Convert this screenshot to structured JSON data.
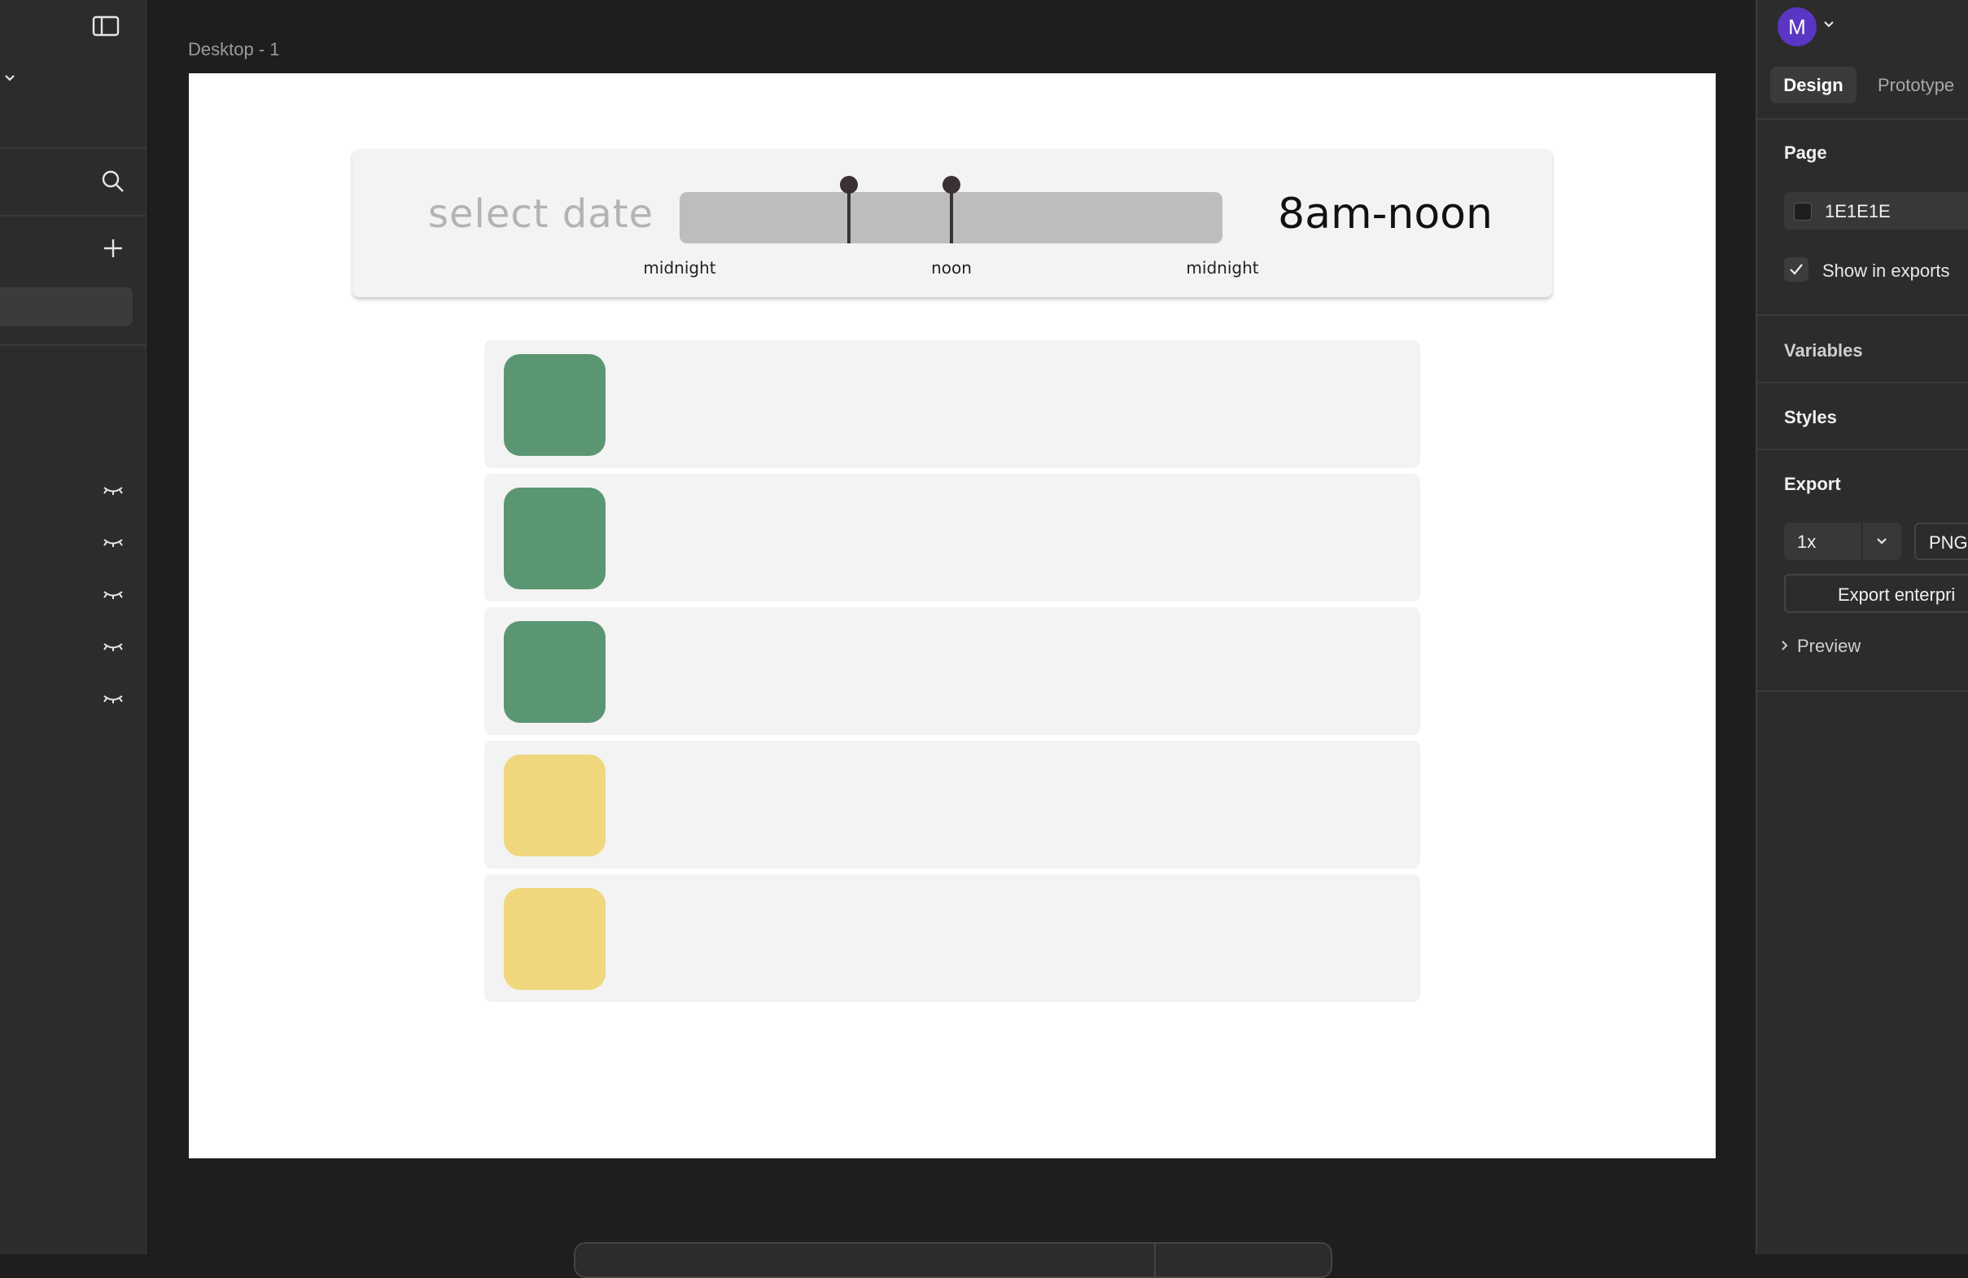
{
  "canvas": {
    "frame_label": "Desktop - 1",
    "background_color": "#1e1e1e",
    "frame_color": "#ffffff"
  },
  "mockup": {
    "date_placeholder": "select date",
    "range_text": "8am-noon",
    "slider": {
      "track_color": "#bdbdbd",
      "handle_color": "#3a3232",
      "start_fraction": 0.3125,
      "end_fraction": 0.5,
      "tick_labels": [
        "midnight",
        "noon",
        "midnight"
      ]
    },
    "rows": [
      {
        "swatch_color": "#5b9672"
      },
      {
        "swatch_color": "#5b9672"
      },
      {
        "swatch_color": "#5b9672"
      },
      {
        "swatch_color": "#f0d77d"
      },
      {
        "swatch_color": "#f0d77d"
      }
    ]
  },
  "left_sidebar": {
    "icons": [
      "sidebar-toggle-icon",
      "chevron-down-icon",
      "search-icon",
      "plus-icon"
    ],
    "hidden_layer_icons": [
      "eye-closed-icon",
      "eye-closed-icon",
      "eye-closed-icon",
      "eye-closed-icon",
      "eye-closed-icon"
    ]
  },
  "right_panel": {
    "avatar_initial": "M",
    "tabs": [
      "Design",
      "Prototype"
    ],
    "page": {
      "title": "Page",
      "color_value": "1E1E1E",
      "show_in_exports_label": "Show in exports",
      "show_in_exports_checked": true
    },
    "variables_title": "Variables",
    "styles_title": "Styles",
    "export": {
      "title": "Export",
      "scale": "1x",
      "format": "PNG",
      "button_label": "Export enterpri",
      "preview_label": "Preview"
    },
    "accent_color": "#5b35c4"
  }
}
